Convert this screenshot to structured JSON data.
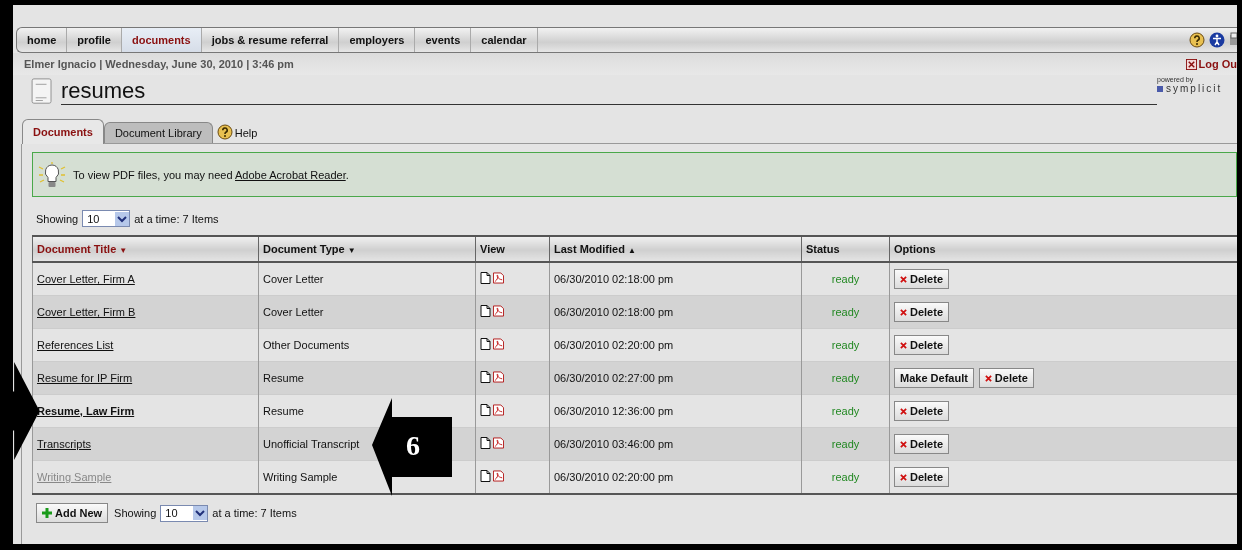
{
  "nav": {
    "tabs": [
      {
        "label": "home",
        "selected": false
      },
      {
        "label": "profile",
        "selected": false
      },
      {
        "label": "documents",
        "selected": true
      },
      {
        "label": "jobs & resume referral",
        "selected": false
      },
      {
        "label": "employers",
        "selected": false
      },
      {
        "label": "events",
        "selected": false
      },
      {
        "label": "calendar",
        "selected": false
      }
    ]
  },
  "user_line": "Elmer Ignacio | Wednesday, June 30, 2010 | 3:46 pm",
  "logout": "Log Ou",
  "powered_by": {
    "caption": "powered by",
    "brand": "symplicit"
  },
  "page_title": "resumes",
  "doc_tabs": [
    {
      "label": "Documents",
      "selected": true
    },
    {
      "label": "Document Library",
      "selected": false
    }
  ],
  "help": "Help",
  "notice": {
    "text": "To view PDF files, you may need ",
    "link": "Adobe Acrobat Reader",
    "after": "."
  },
  "paging_top": {
    "label": "Showing",
    "value": "10",
    "after": "at a time: 7 Items"
  },
  "table": {
    "columns": [
      {
        "label": "Document Title",
        "sort_arrow": "▼",
        "selected": true
      },
      {
        "label": "Document Type",
        "sort_arrow": "▼",
        "selected": false
      },
      {
        "label": "View",
        "selected": false
      },
      {
        "label": "Last Modified",
        "sort_arrow": "▲",
        "selected": false
      },
      {
        "label": "Status",
        "selected": false
      },
      {
        "label": "Options",
        "selected": false
      }
    ],
    "rows": [
      {
        "title": "Cover Letter, Firm A",
        "kind": "normal",
        "type": "Cover Letter",
        "modified": "06/30/2010 02:18:00 pm",
        "status": "ready",
        "options": [
          {
            "label": "Delete",
            "kind": "delete"
          }
        ]
      },
      {
        "title": "Cover Letter, Firm B",
        "kind": "normal",
        "type": "Cover Letter",
        "modified": "06/30/2010 02:18:00 pm",
        "status": "ready",
        "options": [
          {
            "label": "Delete",
            "kind": "delete"
          }
        ]
      },
      {
        "title": "References List",
        "kind": "normal",
        "type": "Other Documents",
        "modified": "06/30/2010 02:20:00 pm",
        "status": "ready",
        "options": [
          {
            "label": "Delete",
            "kind": "delete"
          }
        ]
      },
      {
        "title": "Resume for IP Firm",
        "kind": "normal",
        "type": "Resume",
        "modified": "06/30/2010 02:27:00 pm",
        "status": "ready",
        "options": [
          {
            "label": "Make Default",
            "kind": "plain"
          },
          {
            "label": "Delete",
            "kind": "delete"
          }
        ]
      },
      {
        "title": "Resume, Law Firm",
        "kind": "default",
        "type": "Resume",
        "modified": "06/30/2010 12:36:00 pm",
        "status": "ready",
        "options": [
          {
            "label": "Delete",
            "kind": "delete"
          }
        ]
      },
      {
        "title": "Transcripts",
        "kind": "normal",
        "type": "Unofficial Transcript",
        "modified": "06/30/2010 03:46:00 pm",
        "status": "ready",
        "options": [
          {
            "label": "Delete",
            "kind": "delete"
          }
        ]
      },
      {
        "title": "Writing Sample",
        "kind": "dimmed",
        "type": "Writing Sample",
        "modified": "06/30/2010 02:20:00 pm",
        "status": "ready",
        "options": [
          {
            "label": "Delete",
            "kind": "delete"
          }
        ]
      }
    ]
  },
  "add_button": "Add New",
  "paging_bottom": {
    "label": "Showing",
    "value": "10",
    "after": "at a time: 7 Items"
  },
  "callout": {
    "number": "6"
  }
}
